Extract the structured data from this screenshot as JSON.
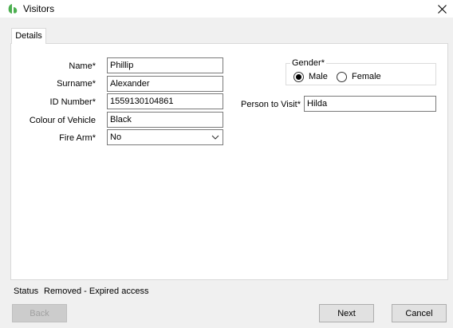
{
  "window": {
    "title": "Visitors"
  },
  "tabs": [
    {
      "label": "Details"
    }
  ],
  "form": {
    "name_label": "Name*",
    "name_value": "Phillip",
    "surname_label": "Surname*",
    "surname_value": "Alexander",
    "id_label": "ID Number*",
    "id_value": "1559130104861",
    "vehicle_label": "Colour of Vehicle",
    "vehicle_value": "Black",
    "firearm_label": "Fire Arm*",
    "firearm_value": "No",
    "gender_legend": "Gender*",
    "gender_male": "Male",
    "gender_female": "Female",
    "gender_selected": "Male",
    "person_label": "Person to Visit*",
    "person_value": "Hilda"
  },
  "status": {
    "label": "Status",
    "value": "Removed - Expired access"
  },
  "buttons": {
    "back": "Back",
    "next": "Next",
    "cancel": "Cancel"
  },
  "colors": {
    "app_icon": "#4caf50"
  },
  "icons": {
    "app": "leaf-icon",
    "close": "close-icon",
    "dropdown": "chevron-down-icon"
  }
}
